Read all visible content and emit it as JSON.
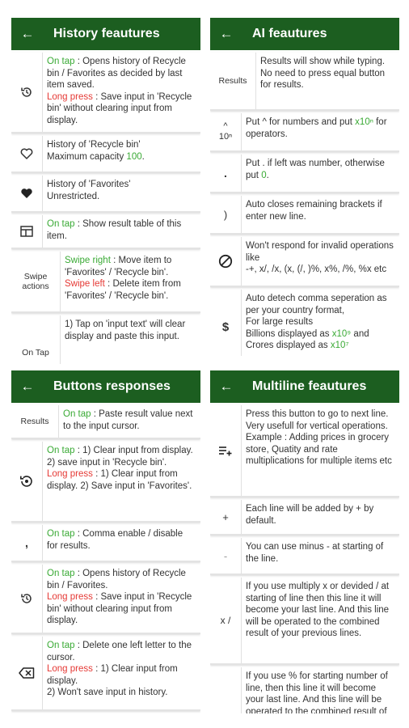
{
  "history": {
    "title": "History feautures",
    "items": [
      {
        "lines": [
          [
            "g",
            "On tap"
          ],
          [
            "n",
            " : Opens history of Recycle bin / Favorites as decided by last item saved."
          ],
          [
            "br"
          ],
          [
            "r",
            "Long press"
          ],
          [
            "n",
            " : Save input in 'Recycle bin' without clearing input from display."
          ]
        ]
      },
      {
        "lines": [
          [
            "n",
            "History of 'Recycle bin'"
          ],
          [
            "br"
          ],
          [
            "n",
            "Maximum capacity "
          ],
          [
            "g",
            "100"
          ],
          [
            "n",
            "."
          ]
        ]
      },
      {
        "lines": [
          [
            "n",
            "History of 'Favorites'"
          ],
          [
            "br"
          ],
          [
            "n",
            "Unrestricted."
          ]
        ]
      },
      {
        "lines": [
          [
            "g",
            "On tap"
          ],
          [
            "n",
            " : Show result table of this item."
          ]
        ]
      },
      {
        "label": "Swipe actions",
        "lines": [
          [
            "g",
            "Swipe right"
          ],
          [
            "n",
            " : Move item to 'Favorites' / 'Recycle bin'."
          ],
          [
            "br"
          ],
          [
            "r",
            "Swipe left"
          ],
          [
            "n",
            " : Delete item from 'Favorites' / 'Recycle bin'."
          ]
        ]
      },
      {
        "label": "On Tap",
        "lines": [
          [
            "n",
            "1) Tap on 'input text' will clear display and paste this input."
          ]
        ]
      }
    ]
  },
  "ai": {
    "title": "AI feautures",
    "items": [
      {
        "label": "Results",
        "lines": [
          [
            "n",
            "Results will show while typing."
          ],
          [
            "br"
          ],
          [
            "n",
            "No need to press equal button for results."
          ]
        ]
      },
      {
        "label": "^",
        "sub": "10ⁿ",
        "lines": [
          [
            "n",
            "Put ^ for numbers and put "
          ],
          [
            "g",
            "x10ⁿ"
          ],
          [
            "n",
            " for operators."
          ]
        ]
      },
      {
        "label": ".",
        "lines": [
          [
            "n",
            "Put . if left was number, otherwise put "
          ],
          [
            "g",
            "0"
          ],
          [
            "n",
            "."
          ]
        ]
      },
      {
        "label": ")",
        "lines": [
          [
            "n",
            "Auto closes remaining brackets if enter new line."
          ]
        ]
      },
      {
        "lines": [
          [
            "n",
            "Won't respond for invalid operations like"
          ],
          [
            "br"
          ],
          [
            "n",
            "-+, x/, /x, (x, (/, )%, x%, /%, %x etc"
          ]
        ]
      },
      {
        "label": "$",
        "lines": [
          [
            "n",
            "Auto detech comma seperation as per your country format,"
          ],
          [
            "br"
          ],
          [
            "n",
            "For large results"
          ],
          [
            "br"
          ],
          [
            "n",
            "Billions displayed as "
          ],
          [
            "g",
            "x10⁹"
          ],
          [
            "n",
            " and Crores displayed as "
          ],
          [
            "g",
            "x10⁷"
          ]
        ]
      }
    ]
  },
  "buttons": {
    "title": "Buttons responses",
    "items": [
      {
        "label": "Results",
        "lines": [
          [
            "g",
            "On tap"
          ],
          [
            "n",
            " : Paste result value next to the input cursor."
          ]
        ]
      },
      {
        "lines": [
          [
            "g",
            "On tap"
          ],
          [
            "n",
            " : 1) Clear input from display."
          ],
          [
            "br"
          ],
          [
            "n",
            "2) save input in 'Recycle bin'."
          ],
          [
            "br"
          ],
          [
            "r",
            "Long press"
          ],
          [
            "n",
            " : 1) Clear input from display.  2) Save input in 'Favorites'."
          ]
        ]
      },
      {
        "label": ",",
        "lines": [
          [
            "g",
            "On tap"
          ],
          [
            "n",
            " : Comma enable / disable for results."
          ]
        ]
      },
      {
        "lines": [
          [
            "g",
            "On tap"
          ],
          [
            "n",
            " : Opens history of Recycle bin / Favorites."
          ],
          [
            "br"
          ],
          [
            "r",
            "Long press"
          ],
          [
            "n",
            " : Save input in 'Recycle bin' without clearing input from display."
          ]
        ]
      },
      {
        "lines": [
          [
            "g",
            "On tap"
          ],
          [
            "n",
            " : Delete one left letter to the cursor."
          ],
          [
            "br"
          ],
          [
            "r",
            "Long press"
          ],
          [
            "n",
            " : 1) Clear input from display."
          ],
          [
            "br"
          ],
          [
            "n",
            "2) Won't save input in history."
          ]
        ]
      }
    ]
  },
  "multiline": {
    "title": "Multiline feautures",
    "items": [
      {
        "lines": [
          [
            "n",
            "Press this button to go to next line."
          ],
          [
            "br"
          ],
          [
            "n",
            "Very usefull for vertical operations. Example : Adding prices in grocery store, Quatity and rate multiplications for multiple items etc"
          ]
        ]
      },
      {
        "label": "+",
        "lines": [
          [
            "n",
            "Each line will be added by + by default."
          ]
        ]
      },
      {
        "label": "-",
        "lines": [
          [
            "n",
            "You can use minus - at starting of the line."
          ]
        ]
      },
      {
        "label": "x /",
        "lines": [
          [
            "n",
            "If you use multiply x or devided / at starting of line then this line it will become your last line. And this line will be operated to the combined result of your previous lines."
          ]
        ]
      },
      {
        "label": "%",
        "lines": [
          [
            "n",
            "If you use % for starting number of line, then this line it will become your last line. And this line will be operated to the combined result of your previous lines."
          ]
        ]
      }
    ]
  }
}
